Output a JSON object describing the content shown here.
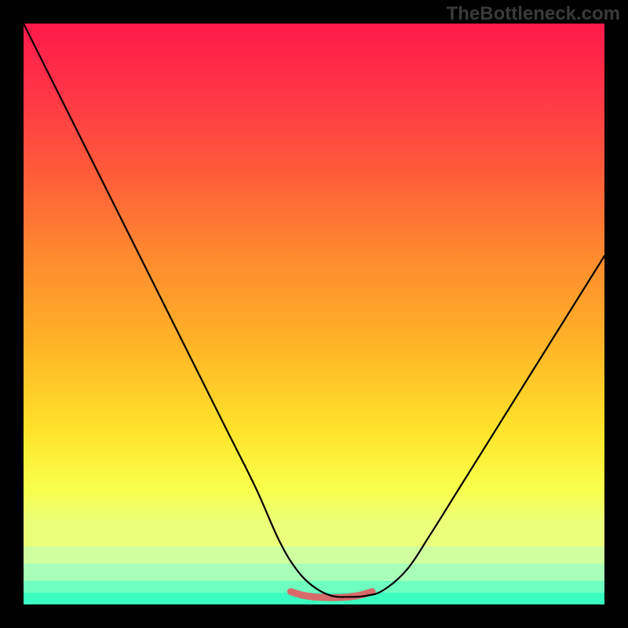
{
  "watermark": "TheBottleneck.com",
  "chart_data": {
    "type": "line",
    "title": "",
    "xlabel": "",
    "ylabel": "",
    "xlim": [
      0,
      100
    ],
    "ylim": [
      0,
      100
    ],
    "grid": false,
    "legend": false,
    "series": [
      {
        "name": "curve",
        "color": "#000000",
        "x": [
          0,
          5,
          10,
          15,
          20,
          25,
          30,
          35,
          40,
          44,
          47,
          50,
          53,
          56,
          59,
          62,
          66,
          70,
          75,
          80,
          85,
          90,
          95,
          100
        ],
        "values": [
          100,
          90,
          80,
          70,
          60,
          50,
          40,
          30,
          20,
          11,
          6,
          3,
          1.5,
          1.3,
          1.5,
          2.5,
          6,
          12,
          20,
          28,
          36,
          44,
          52,
          60
        ]
      },
      {
        "name": "bottom-marker",
        "color": "#d86a6a",
        "x": [
          46,
          48,
          50,
          52,
          54,
          56,
          58,
          60
        ],
        "values": [
          2.2,
          1.6,
          1.3,
          1.2,
          1.2,
          1.3,
          1.6,
          2.2
        ]
      }
    ],
    "background_gradient": {
      "type": "vertical",
      "stops": [
        {
          "pos": 0.0,
          "color": "#ff1a4b"
        },
        {
          "pos": 0.12,
          "color": "#ff3546"
        },
        {
          "pos": 0.25,
          "color": "#ff5a3a"
        },
        {
          "pos": 0.4,
          "color": "#ff8a2f"
        },
        {
          "pos": 0.55,
          "color": "#ffb327"
        },
        {
          "pos": 0.7,
          "color": "#ffe32a"
        },
        {
          "pos": 0.8,
          "color": "#f9ff4a"
        },
        {
          "pos": 0.86,
          "color": "#eaff7a"
        },
        {
          "pos": 0.9,
          "color": "#d0ffa0"
        },
        {
          "pos": 0.93,
          "color": "#a8ffb8"
        },
        {
          "pos": 0.96,
          "color": "#6effc0"
        },
        {
          "pos": 0.98,
          "color": "#3affc0"
        },
        {
          "pos": 1.0,
          "color": "#18e8a8"
        }
      ]
    }
  }
}
